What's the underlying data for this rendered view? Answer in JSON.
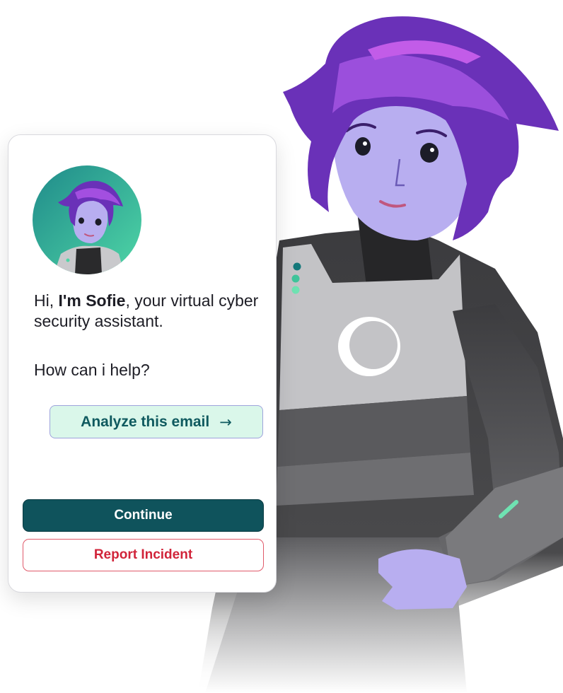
{
  "assistant": {
    "name": "I'm Sofie",
    "greeting_prefix": "Hi, ",
    "greeting_suffix": ", your virtual cyber security assistant.",
    "prompt": "How can i help?"
  },
  "suggestion": {
    "label": "Analyze this email",
    "icon": "arrow-right-icon"
  },
  "actions": {
    "continue_label": "Continue",
    "report_label": "Report Incident"
  },
  "colors": {
    "primary": "#0f535c",
    "danger": "#d1243a",
    "suggest_bg": "#daf7ea",
    "hair": "#6a31b8",
    "skin": "#b8aef0"
  }
}
